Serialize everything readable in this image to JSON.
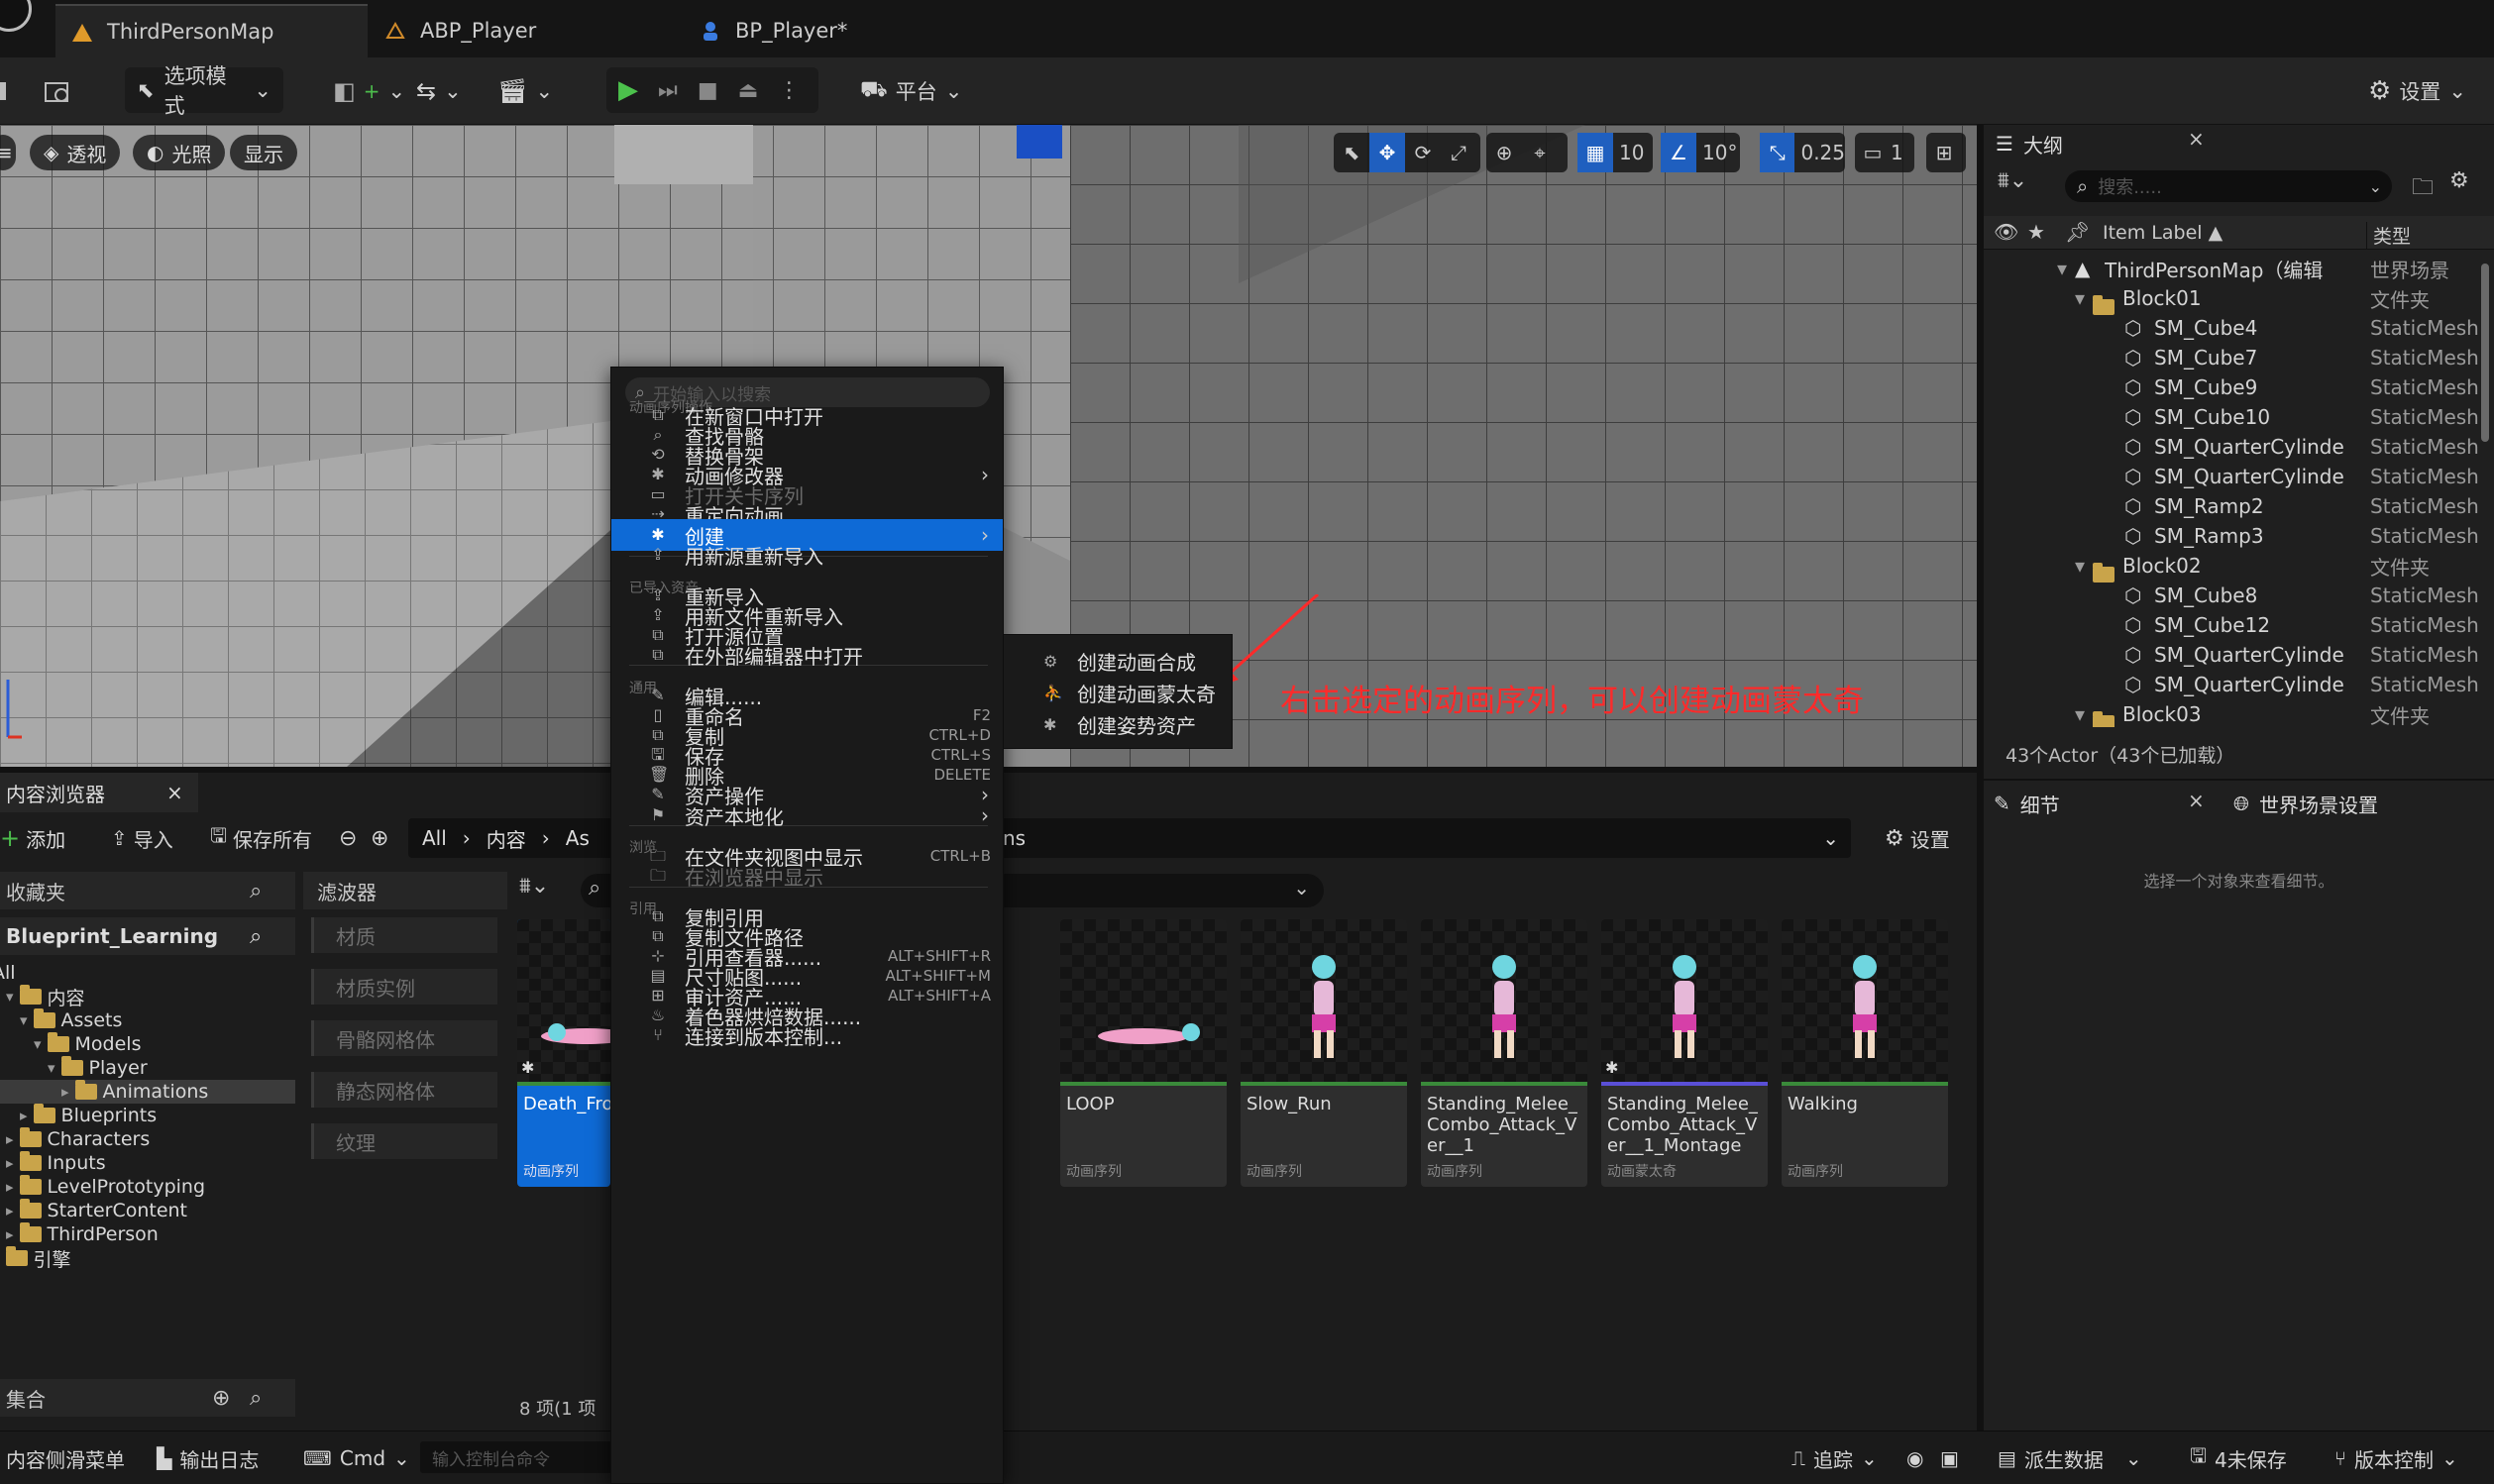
{
  "tabs": [
    {
      "label": "ThirdPersonMap"
    },
    {
      "label": "ABP_Player"
    },
    {
      "label": "BP_Player*"
    }
  ],
  "toolbar": {
    "mode_label": "选项模式",
    "platform_label": "平台",
    "settings_label": "设置"
  },
  "viewport": {
    "perspective_label": "透视",
    "lighting_label": "光照",
    "show_label": "显示",
    "grid_snap": "10",
    "rotation_snap": "10°",
    "scale_snap": "0.25",
    "camera_speed": "1"
  },
  "annotation": {
    "text": "右击选定的动画序列，可以创建动画蒙太奇",
    "color": "#ff2a2a"
  },
  "outliner": {
    "tab_label": "大纲",
    "search_placeholder": "搜索.....",
    "col_label": "Item Label ▲",
    "col_type": "类型",
    "rows": [
      {
        "label": "ThirdPersonMap（编辑",
        "type": "世界场景",
        "indent": 0,
        "kind": "map"
      },
      {
        "label": "Block01",
        "type": "文件夹",
        "indent": 1,
        "kind": "folder"
      },
      {
        "label": "SM_Cube4",
        "type": "StaticMesh",
        "indent": 2,
        "kind": "mesh"
      },
      {
        "label": "SM_Cube7",
        "type": "StaticMesh",
        "indent": 2,
        "kind": "mesh"
      },
      {
        "label": "SM_Cube9",
        "type": "StaticMesh",
        "indent": 2,
        "kind": "mesh"
      },
      {
        "label": "SM_Cube10",
        "type": "StaticMesh",
        "indent": 2,
        "kind": "mesh"
      },
      {
        "label": "SM_QuarterCylinde",
        "type": "StaticMesh",
        "indent": 2,
        "kind": "mesh"
      },
      {
        "label": "SM_QuarterCylinde",
        "type": "StaticMesh",
        "indent": 2,
        "kind": "mesh"
      },
      {
        "label": "SM_Ramp2",
        "type": "StaticMesh",
        "indent": 2,
        "kind": "mesh"
      },
      {
        "label": "SM_Ramp3",
        "type": "StaticMesh",
        "indent": 2,
        "kind": "mesh"
      },
      {
        "label": "Block02",
        "type": "文件夹",
        "indent": 1,
        "kind": "folder"
      },
      {
        "label": "SM_Cube8",
        "type": "StaticMesh",
        "indent": 2,
        "kind": "mesh"
      },
      {
        "label": "SM_Cube12",
        "type": "StaticMesh",
        "indent": 2,
        "kind": "mesh"
      },
      {
        "label": "SM_QuarterCylinde",
        "type": "StaticMesh",
        "indent": 2,
        "kind": "mesh"
      },
      {
        "label": "SM_QuarterCylinde",
        "type": "StaticMesh",
        "indent": 2,
        "kind": "mesh"
      },
      {
        "label": "Block03",
        "type": "文件夹",
        "indent": 1,
        "kind": "folder"
      }
    ],
    "actor_count": "43个Actor（43个已加载）"
  },
  "details": {
    "tab_label": "细节",
    "world_tab_label": "世界场景设置",
    "empty_hint": "选择一个对象来查看细节。"
  },
  "content_browser": {
    "tab_label": "内容浏览器",
    "add_label": "添加",
    "import_label": "导入",
    "save_all_label": "保存所有",
    "path": [
      "All",
      "内容",
      "As"
    ],
    "path_tail": "ns",
    "settings_label": "设置",
    "favorites_label": "收藏夹",
    "project_label": "Blueprint_Learning",
    "filters_label": "滤波器",
    "collections_label": "集合",
    "item_count": "8 项(1 项",
    "tree": [
      {
        "label": "All",
        "indent": 0
      },
      {
        "label": "内容",
        "indent": 1
      },
      {
        "label": "Assets",
        "indent": 2
      },
      {
        "label": "Models",
        "indent": 3
      },
      {
        "label": "Player",
        "indent": 4
      },
      {
        "label": "Animations",
        "indent": 5,
        "selected": true
      },
      {
        "label": "Blueprints",
        "indent": 2
      },
      {
        "label": "Characters",
        "indent": 1
      },
      {
        "label": "Inputs",
        "indent": 1
      },
      {
        "label": "LevelPrototyping",
        "indent": 1
      },
      {
        "label": "StarterContent",
        "indent": 1
      },
      {
        "label": "ThirdPerson",
        "indent": 1
      },
      {
        "label": "引擎",
        "indent": 0
      }
    ],
    "filters": [
      "材质",
      "材质实例",
      "骨骼网格体",
      "静态网格体",
      "纹理"
    ],
    "assets": [
      {
        "name": "Death_From",
        "kind": "动画序列",
        "selected": true
      },
      {
        "name": "LOOP",
        "kind": "动画序列"
      },
      {
        "name": "Slow_Run",
        "kind": "动画序列"
      },
      {
        "name": "Standing_Melee_Combo_Attack_Ver__1",
        "kind": "动画序列"
      },
      {
        "name": "Standing_Melee_Combo_Attack_Ver__1_Montage",
        "kind": "动画蒙太奇"
      },
      {
        "name": "Walking",
        "kind": "动画序列"
      }
    ]
  },
  "context_menu": {
    "search_placeholder": "开始输入以搜索",
    "sections": {
      "anim": "动画序列操作",
      "imported": "已导入资产",
      "common": "通用",
      "explore": "浏览",
      "reference": "引用"
    },
    "items": [
      {
        "label": "在新窗口中打开"
      },
      {
        "label": "查找骨骼"
      },
      {
        "label": "替换骨架"
      },
      {
        "label": "动画修改器",
        "submenu": true
      },
      {
        "label": "打开关卡序列",
        "disabled": true
      },
      {
        "label": "重定向动画"
      },
      {
        "label": "创建",
        "submenu": true,
        "selected": true
      },
      {
        "label": "用新源重新导入"
      },
      {
        "label": "重新导入"
      },
      {
        "label": "用新文件重新导入"
      },
      {
        "label": "打开源位置"
      },
      {
        "label": "在外部编辑器中打开"
      },
      {
        "label": "编辑......"
      },
      {
        "label": "重命名",
        "shortcut": "F2"
      },
      {
        "label": "复制",
        "shortcut": "CTRL+D"
      },
      {
        "label": "保存",
        "shortcut": "CTRL+S"
      },
      {
        "label": "删除",
        "shortcut": "DELETE"
      },
      {
        "label": "资产操作",
        "submenu": true
      },
      {
        "label": "资产本地化",
        "submenu": true
      },
      {
        "label": "在文件夹视图中显示",
        "shortcut": "CTRL+B"
      },
      {
        "label": "在浏览器中显示",
        "disabled": true
      },
      {
        "label": "复制引用"
      },
      {
        "label": "复制文件路径"
      },
      {
        "label": "引用查看器......",
        "shortcut": "ALT+SHIFT+R"
      },
      {
        "label": "尺寸贴图......",
        "shortcut": "ALT+SHIFT+M"
      },
      {
        "label": "审计资产......",
        "shortcut": "ALT+SHIFT+A"
      },
      {
        "label": "着色器烘焙数据......"
      },
      {
        "label": "连接到版本控制..."
      }
    ],
    "create_submenu": [
      {
        "label": "创建动画合成"
      },
      {
        "label": "创建动画蒙太奇"
      },
      {
        "label": "创建姿势资产"
      }
    ]
  },
  "statusbar": {
    "drawer_label": "内容侧滑菜单",
    "output_log_label": "输出日志",
    "cmd_label": "Cmd",
    "console_placeholder": "输入控制台命令",
    "trace_label": "追踪",
    "derived_data_label": "派生数据",
    "unsaved_label": "4未保存",
    "source_control_label": "版本控制"
  }
}
